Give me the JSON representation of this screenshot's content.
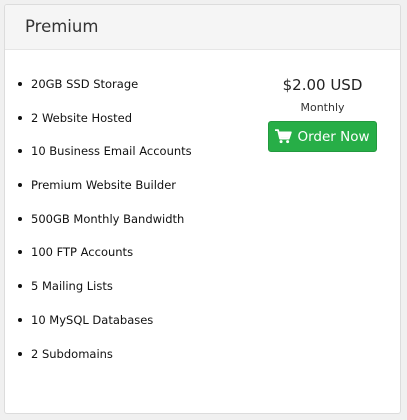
{
  "plan": {
    "title": "Premium",
    "features": [
      "20GB SSD Storage",
      "2 Website Hosted",
      "10 Business Email Accounts",
      "Premium Website Builder",
      "500GB Monthly Bandwidth",
      "100 FTP Accounts",
      "5 Mailing Lists",
      "10 MySQL Databases",
      "2 Subdomains"
    ],
    "price": "$2.00 USD",
    "billing_cycle": "Monthly",
    "order_button": {
      "label": "Order Now",
      "icon": "shopping-cart-icon",
      "color": "#27ae47"
    }
  }
}
